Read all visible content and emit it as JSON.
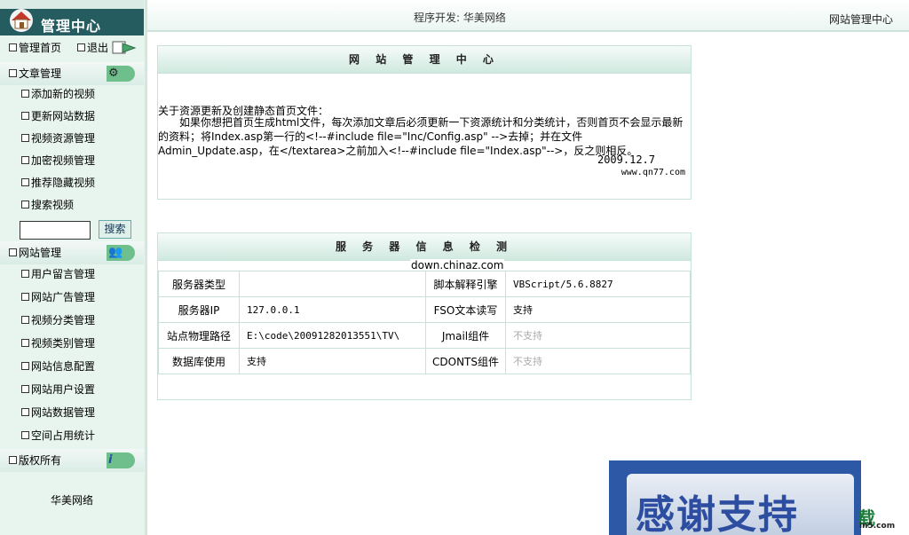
{
  "sidebar": {
    "title": "管理中心",
    "home_label": "管理首页",
    "logout_label": "退出",
    "sections": {
      "articles": {
        "label": "文章管理",
        "items": [
          "添加新的视频",
          "更新网站数据",
          "视频资源管理",
          "加密视频管理",
          "推荐隐藏视频",
          "搜索视频"
        ]
      },
      "site": {
        "label": "网站管理",
        "items": [
          "用户留言管理",
          "网站广告管理",
          "视频分类管理",
          "视频类别管理",
          "网站信息配置",
          "网站用户设置",
          "网站数据管理",
          "空间占用统计"
        ]
      },
      "copyright": {
        "label": "版权所有"
      }
    },
    "search": {
      "value": "",
      "button_label": "搜索"
    },
    "footer": "华美网络"
  },
  "topbar": {
    "developer": "程序开发: 华美网络",
    "right_title": "网站管理中心"
  },
  "notice_panel": {
    "title": "网 站 管 理 中 心",
    "heading": "关于资源更新及创建静态首页文件：",
    "body": "如果你想把首页生成html文件，每次添加文章后必须更新一下资源统计和分类统计，否则首页不会显示最新的资料；将Index.asp第一行的<!--#include file=\"Inc/Config.asp\" -->去掉；并在文件Admin_Update.asp，在</textarea>之前加入<!--#include file=\"Index.asp\"-->，反之则相反。",
    "date": "2009.12.7",
    "site": "www.qn77.com"
  },
  "server_panel": {
    "title": "服 务 器 信 息 检 测",
    "watermark": "down.chinaz.com",
    "rows": [
      {
        "label1": "服务器类型",
        "value1": "",
        "label2": "脚本解释引擎",
        "value2": "VBScript/5.6.8827"
      },
      {
        "label1": "服务器IP",
        "value1": "127.0.0.1",
        "label2": "FSO文本读写",
        "value2": "支持"
      },
      {
        "label1": "站点物理路径",
        "value1": "E:\\code\\20091282013551\\TV\\",
        "label2": "Jmail组件",
        "value2": "不支持"
      },
      {
        "label1": "数据库使用",
        "value1": "支持",
        "label2": "CDONTS组件",
        "value2": "不支持"
      }
    ]
  },
  "banner": {
    "text": "感谢支持",
    "corner_logo": "载",
    "corner_site": "in5.com"
  },
  "colors": {
    "sidebar_bg": "#e8f4ee",
    "logo_bar": "#255c60",
    "panel_border": "#c9e2d9",
    "banner_bg": "#2d58a6",
    "muted_text": "#aaaaaa"
  }
}
